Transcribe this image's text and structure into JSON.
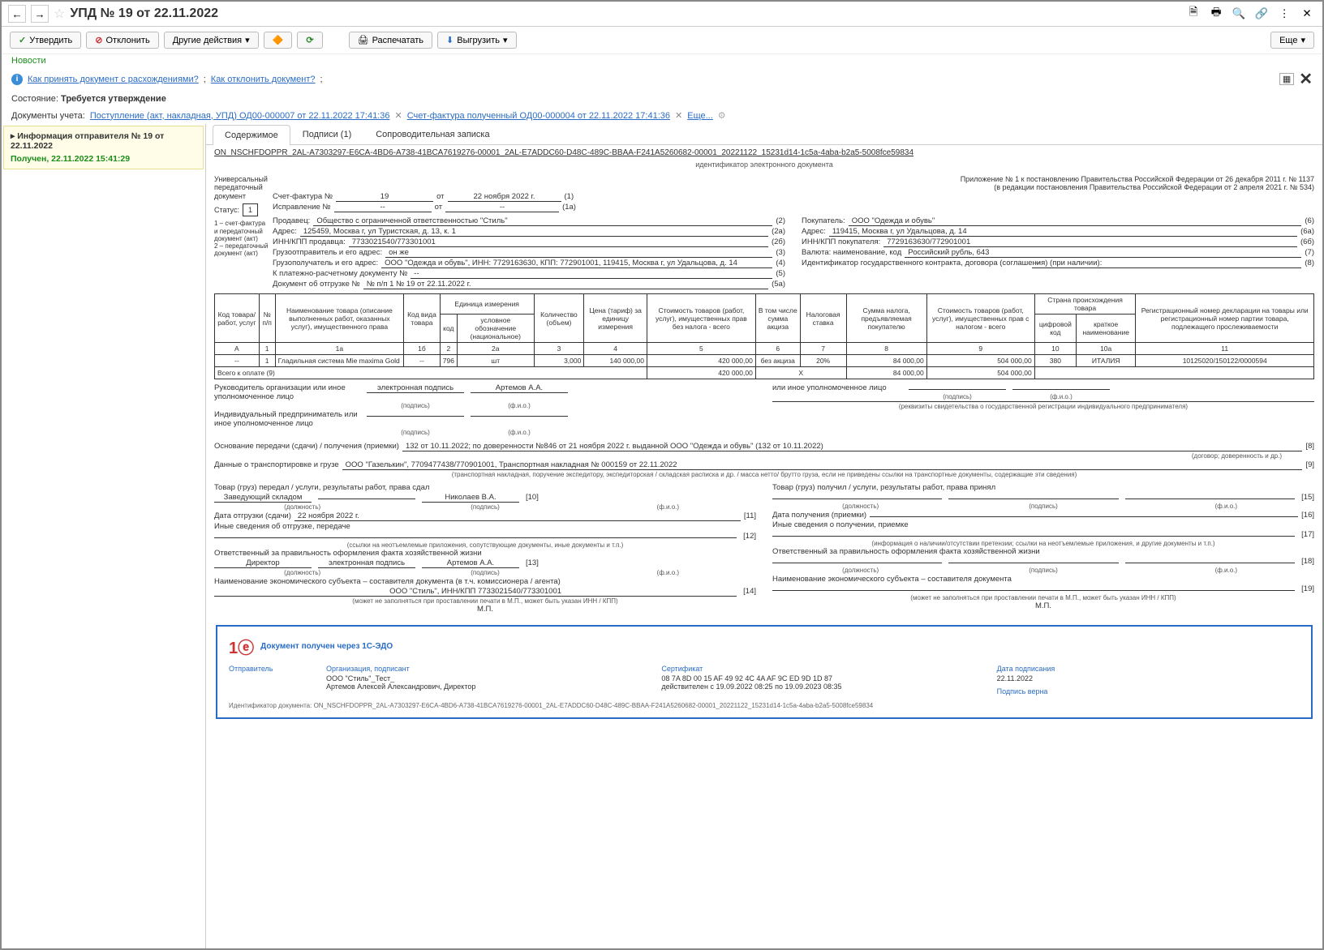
{
  "title": "УПД № 19 от 22.11.2022",
  "toolbar": {
    "approve": "Утвердить",
    "reject": "Отклонить",
    "other_actions": "Другие действия",
    "print": "Распечатать",
    "export": "Выгрузить",
    "more": "Еще"
  },
  "news": "Новости",
  "help": {
    "link1": "Как принять документ с расхождениями?",
    "link2": "Как отклонить документ?"
  },
  "state": {
    "label": "Состояние:",
    "value": "Требуется утверждение"
  },
  "docs": {
    "label": "Документы учета:",
    "link1": "Поступление (акт, накладная, УПД) ОД00-000007 от 22.11.2022 17:41:36",
    "link2": "Счет-фактура полученный ОД00-000004 от 22.11.2022 17:41:36",
    "more": "Еще..."
  },
  "sidebar": {
    "sender_title": "Информация отправителя № 19 от 22.11.2022",
    "sender_status": "Получен, 22.11.2022 15:41:29"
  },
  "tabs": {
    "t1": "Содержимое",
    "t2": "Подписи (1)",
    "t3": "Сопроводительная записка"
  },
  "doc_id": "ON_NSCHFDOPPR_2AL-A7303297-E6CA-4BD6-A738-41BCA7619276-00001_2AL-E7ADDC60-D48C-489C-BBAA-F241A5260682-00001_20221122_15231d14-1c5a-4aba-b2a5-5008fce59834",
  "doc_id_sub": "идентификатор электронного документа",
  "leftnote": {
    "l1": "Универсальный передаточный документ",
    "l2": "Статус:",
    "l3": "1",
    "l4": "1 – счет-фактура и передаточный документ (акт)\n2 – передаточный документ (акт)"
  },
  "rightnote": {
    "r1": "Приложение № 1 к постановлению Правительства Российской Федерации от 26 декабря 2011 г. № 1137",
    "r2": "(в редакции постановления Правительства Российской Федерации от 2 апреля 2021 г. № 534)"
  },
  "header": {
    "invoice_no_label": "Счет-фактура №",
    "invoice_no": "19",
    "of": "от",
    "invoice_date": "22 ноября 2022 г.",
    "p1": "(1)",
    "correction_label": "Исправление №",
    "correction_no": "--",
    "correction_date": "--",
    "p1a": "(1а)",
    "seller_label": "Продавец:",
    "seller": "Общество с ограниченной ответственностью \"Стиль\"",
    "p2": "(2)",
    "addr_label": "Адрес:",
    "seller_addr": "125459, Москва г, ул Туристская, д. 13, к. 1",
    "p2a": "(2а)",
    "inn_label": "ИНН/КПП продавца:",
    "seller_inn": "7733021540/773301001",
    "p2b": "(2б)",
    "shipper_label": "Грузоотправитель и его адрес:",
    "shipper": "он же",
    "p3": "(3)",
    "consignee_label": "Грузополучатель и его адрес:",
    "consignee": "ООО \"Одежда и обувь\", ИНН: 7729163630, КПП: 772901001, 119415, Москва г, ул Удальцова, д. 14",
    "p4": "(4)",
    "payment_label": "К платежно-расчетному документу №",
    "payment": "--",
    "p5": "(5)",
    "shipdoc_label": "Документ об отгрузке №",
    "shipdoc": "№ п/п 1 № 19 от 22.11.2022 г.",
    "p5a": "(5а)",
    "buyer_label": "Покупатель:",
    "buyer": "ООО \"Одежда и обувь\"",
    "p6": "(6)",
    "buyer_addr": "119415, Москва г, ул Удальцова, д. 14",
    "p6a": "(6а)",
    "buyer_inn_label": "ИНН/КПП покупателя:",
    "buyer_inn": "7729163630/772901001",
    "p6b": "(6б)",
    "currency_label": "Валюта: наименование, код",
    "currency": "Российский рубль, 643",
    "p7": "(7)",
    "contract_label": "Идентификатор государственного контракта, договора (соглашения) (при наличии):",
    "contract": "--",
    "p8": "(8)"
  },
  "table_headers": {
    "h1": "Код товара/ работ, услуг",
    "h2": "№ п/п",
    "h3": "Наименование товара (описание выполненных работ, оказанных услуг), имущественного права",
    "h4": "Код вида товара",
    "h5": "Единица измерения",
    "h5a": "код",
    "h5b": "условное обозначение (национальное)",
    "h6": "Количество (объем)",
    "h7": "Цена (тариф) за единицу измерения",
    "h8": "Стоимость товаров (работ, услуг), имущественных прав без налога - всего",
    "h9": "В том числе сумма акциза",
    "h10": "Налоговая ставка",
    "h11": "Сумма налога, предъявляемая покупателю",
    "h12": "Стоимость товаров (работ, услуг), имущественных прав с налогом - всего",
    "h13": "Страна происхождения товара",
    "h13a": "цифровой код",
    "h13b": "краткое наименование",
    "h14": "Регистрационный номер декларации на товары или регистрационный номер партии товара, подлежащего прослеживаемости"
  },
  "col_nums": {
    "c1": "А",
    "c2": "1",
    "c3": "1а",
    "c4": "1б",
    "c5": "2",
    "c6": "2а",
    "c7": "3",
    "c8": "4",
    "c9": "5",
    "c10": "6",
    "c11": "7",
    "c12": "8",
    "c13": "9",
    "c14": "10",
    "c15": "10а",
    "c16": "11"
  },
  "rows": [
    {
      "code": "--",
      "n": "1",
      "name": "Гладильная система Mie maxima Gold",
      "kind": "--",
      "ucode": "796",
      "uname": "шт",
      "qty": "3,000",
      "price": "140 000,00",
      "cost": "420 000,00",
      "excise": "без акциза",
      "rate": "20%",
      "tax": "84 000,00",
      "total": "504 000,00",
      "ccode": "380",
      "cname": "ИТАЛИЯ",
      "decl": "10125020/150122/0000594"
    }
  ],
  "total_row": {
    "label": "Всего к оплате (9)",
    "cost": "420 000,00",
    "x": "Х",
    "tax": "84 000,00",
    "total": "504 000,00"
  },
  "sigs": {
    "head_label": "Руководитель организации или иное уполномоченное лицо",
    "head_sig": "электронная подпись",
    "head_name": "Артемов А.А.",
    "other_label": "или иное уполномоченное лицо",
    "sig_cap": "(подпись)",
    "fio_cap": "(ф.и.о.)",
    "ip_label": "Индивидуальный предприниматель или иное уполномоченное лицо",
    "ip_note": "(реквизиты свидетельства о государственной регистрации индивидуального предпринимателя)"
  },
  "bottom": {
    "basis_label": "Основание передачи (сдачи) / получения (приемки)",
    "basis": "132 от 10.11.2022; по доверенности №846 от 21 ноября 2022 г. выданной ООО \"Одежда и обувь\" (132 от 10.11.2022)",
    "basis_cap": "(договор; доверенность и др.)",
    "p8": "[8]",
    "transport_label": "Данные о транспортировке и грузе",
    "transport": "ООО \"Газелькин\", 7709477438/770901001, Транспортная накладная № 000159 от 22.11.2022",
    "transport_cap": "(транспортная накладная, поручение экспедитору, экспедиторская / складская расписка и др. / масса нетто/ брутто груза, если не приведены ссылки на транспортные документы, содержащие эти сведения)",
    "p9": "[9]",
    "left": {
      "title": "Товар (груз) передал / услуги, результаты работ, права сдал",
      "pos": "Заведующий складом",
      "name": "Николаев В.А.",
      "p10": "[10]",
      "pos_cap": "(должность)",
      "date_label": "Дата отгрузки (сдачи)",
      "date": "22 ноября 2022 г.",
      "p11": "[11]",
      "other_label": "Иные сведения об отгрузке, передаче",
      "p12": "[12]",
      "other_cap": "(ссылки на неотъемлемые приложения, сопутствующие документы, иные документы и т.п.)",
      "resp_label": "Ответственный за правильность оформления факта хозяйственной жизни",
      "resp_pos": "Директор",
      "resp_sig": "электронная подпись",
      "resp_name": "Артемов А.А.",
      "p13": "[13]",
      "entity_label": "Наименование экономического субъекта – составителя документа (в т.ч. комиссионера / агента)",
      "entity": "ООО \"Стиль\", ИНН/КПП 7733021540/773301001",
      "p14": "[14]",
      "entity_cap": "(может не заполняться при проставлении печати в М.П., может быть указан ИНН / КПП)",
      "mp": "М.П."
    },
    "right": {
      "title": "Товар (груз) получил / услуги, результаты работ, права принял",
      "p15": "[15]",
      "date_label": "Дата получения (приемки)",
      "p16": "[16]",
      "other_label": "Иные сведения о получении, приемке",
      "p17": "[17]",
      "other_cap": "(информация о наличии/отсутствии претензии; ссылки на неотъемлемые приложения, и другие документы и т.п.)",
      "resp_label": "Ответственный за правильность оформления факта хозяйственной жизни",
      "p18": "[18]",
      "entity_label": "Наименование экономического субъекта – составителя документа",
      "p19": "[19]",
      "entity_cap": "(может не заполняться при проставлении печати в М.П., может быть указан ИНН / КПП)",
      "mp": "М.П."
    }
  },
  "edo": {
    "title": "Документ получен через 1С-ЭДО",
    "sender_label": "Отправитель",
    "org_label": "Организация, подписант",
    "org": "ООО \"Стиль\"_Тест_\nАртемов Алексей Александрович, Директор",
    "cert_label": "Сертификат",
    "cert": "08 7A 8D 00 15 AF 49 92 4C 4A AF 9C ED 9D 1D 87\nдействителен с 19.09.2022 08:25 по 19.09.2023 08:35",
    "date_label": "Дата подписания",
    "date": "22.11.2022",
    "valid": "Подпись верна",
    "id_label": "Идентификатор документа:",
    "id": "ON_NSCHFDOPPR_2AL-A7303297-E6CA-4BD6-A738-41BCA7619276-00001_2AL-E7ADDC60-D48C-489C-BBAA-F241A5260682-00001_20221122_15231d14-1c5a-4aba-b2a5-5008fce59834"
  }
}
